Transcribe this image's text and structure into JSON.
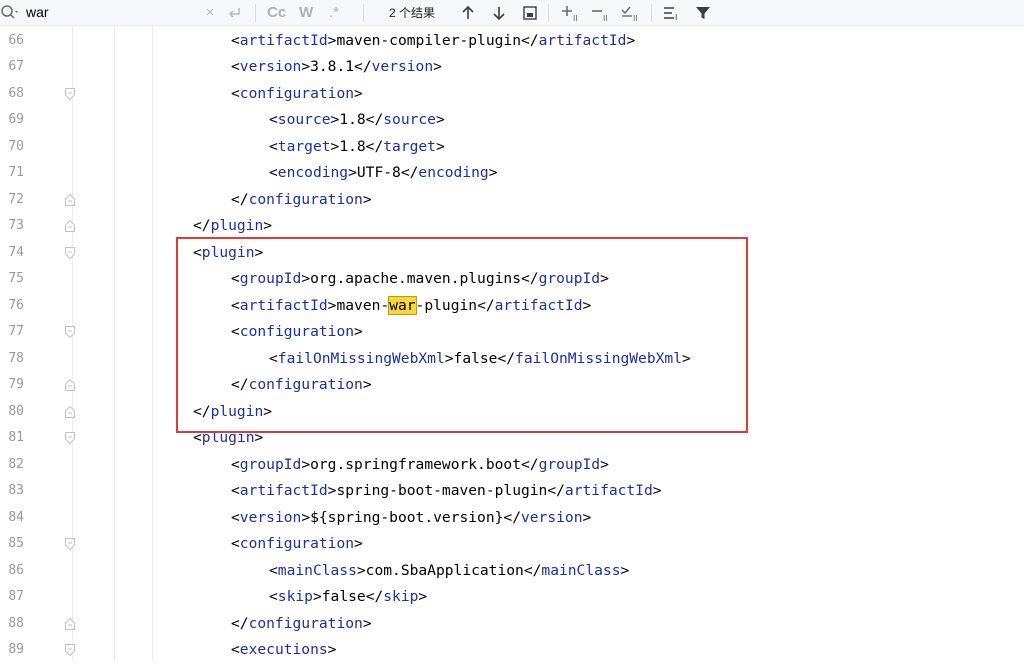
{
  "search": {
    "query": "war",
    "match_case_label": "Cc",
    "words_label": "W",
    "regex_label": ".*",
    "result_count": "2 个结果",
    "icons": [
      "search-icon",
      "clear-icon",
      "replace-toggle-icon",
      "match-case-icon",
      "words-icon",
      "regex-icon",
      "prev-occurrence-icon",
      "next-occurrence-icon",
      "open-in-window-icon",
      "add-selection-icon",
      "remove-selection-icon",
      "select-all-icon",
      "filter-icon",
      "funnel-icon"
    ]
  },
  "editor": {
    "lines": [
      {
        "num": "66",
        "indent": 2,
        "parts": [
          [
            "br",
            "<"
          ],
          [
            "tag",
            "artifactId"
          ],
          [
            "br",
            ">"
          ],
          [
            "txt",
            "maven-compiler-plugin"
          ],
          [
            "br",
            "</"
          ],
          [
            "tag",
            "artifactId"
          ],
          [
            "br",
            ">"
          ]
        ]
      },
      {
        "num": "67",
        "indent": 2,
        "parts": [
          [
            "br",
            "<"
          ],
          [
            "tag",
            "version"
          ],
          [
            "br",
            ">"
          ],
          [
            "txt",
            "3.8.1"
          ],
          [
            "br",
            "</"
          ],
          [
            "tag",
            "version"
          ],
          [
            "br",
            ">"
          ]
        ]
      },
      {
        "num": "68",
        "indent": 2,
        "parts": [
          [
            "br",
            "<"
          ],
          [
            "tag",
            "configuration"
          ],
          [
            "br",
            ">"
          ]
        ]
      },
      {
        "num": "69",
        "indent": 3,
        "parts": [
          [
            "br",
            "<"
          ],
          [
            "tag",
            "source"
          ],
          [
            "br",
            ">"
          ],
          [
            "txt",
            "1.8"
          ],
          [
            "br",
            "</"
          ],
          [
            "tag",
            "source"
          ],
          [
            "br",
            ">"
          ]
        ]
      },
      {
        "num": "70",
        "indent": 3,
        "parts": [
          [
            "br",
            "<"
          ],
          [
            "tag",
            "target"
          ],
          [
            "br",
            ">"
          ],
          [
            "txt",
            "1.8"
          ],
          [
            "br",
            "</"
          ],
          [
            "tag",
            "target"
          ],
          [
            "br",
            ">"
          ]
        ]
      },
      {
        "num": "71",
        "indent": 3,
        "parts": [
          [
            "br",
            "<"
          ],
          [
            "tag",
            "encoding"
          ],
          [
            "br",
            ">"
          ],
          [
            "txt",
            "UTF-8"
          ],
          [
            "br",
            "</"
          ],
          [
            "tag",
            "encoding"
          ],
          [
            "br",
            ">"
          ]
        ]
      },
      {
        "num": "72",
        "indent": 2,
        "parts": [
          [
            "br",
            "</"
          ],
          [
            "tag",
            "configuration"
          ],
          [
            "br",
            ">"
          ]
        ]
      },
      {
        "num": "73",
        "indent": 1,
        "parts": [
          [
            "br",
            "</"
          ],
          [
            "tag",
            "plugin"
          ],
          [
            "br",
            ">"
          ]
        ]
      },
      {
        "num": "74",
        "indent": 1,
        "parts": [
          [
            "br",
            "<"
          ],
          [
            "tag",
            "plugin"
          ],
          [
            "br",
            ">"
          ]
        ]
      },
      {
        "num": "75",
        "indent": 2,
        "parts": [
          [
            "br",
            "<"
          ],
          [
            "tag",
            "groupId"
          ],
          [
            "br",
            ">"
          ],
          [
            "txt",
            "org.apache.maven.plugins"
          ],
          [
            "br",
            "</"
          ],
          [
            "tag",
            "groupId"
          ],
          [
            "br",
            ">"
          ]
        ]
      },
      {
        "num": "76",
        "indent": 2,
        "parts": [
          [
            "br",
            "<"
          ],
          [
            "tag",
            "artifactId"
          ],
          [
            "br",
            ">"
          ],
          [
            "txt",
            "maven-"
          ],
          [
            "hl",
            "war"
          ],
          [
            "txt",
            "-plugin"
          ],
          [
            "br",
            "</"
          ],
          [
            "tag",
            "artifactId"
          ],
          [
            "br",
            ">"
          ]
        ]
      },
      {
        "num": "77",
        "indent": 2,
        "parts": [
          [
            "br",
            "<"
          ],
          [
            "tag",
            "configuration"
          ],
          [
            "br",
            ">"
          ]
        ]
      },
      {
        "num": "78",
        "indent": 3,
        "parts": [
          [
            "br",
            "<"
          ],
          [
            "tag",
            "failOnMissingWebXml"
          ],
          [
            "br",
            ">"
          ],
          [
            "txt",
            "false"
          ],
          [
            "br",
            "</"
          ],
          [
            "tag",
            "failOnMissingWebXml"
          ],
          [
            "br",
            ">"
          ]
        ]
      },
      {
        "num": "79",
        "indent": 2,
        "parts": [
          [
            "br",
            "</"
          ],
          [
            "tag",
            "configuration"
          ],
          [
            "br",
            ">"
          ]
        ]
      },
      {
        "num": "80",
        "indent": 1,
        "parts": [
          [
            "br",
            "</"
          ],
          [
            "tag",
            "plugin"
          ],
          [
            "br",
            ">"
          ]
        ]
      },
      {
        "num": "81",
        "indent": 1,
        "parts": [
          [
            "br",
            "<"
          ],
          [
            "tag",
            "plugin"
          ],
          [
            "br",
            ">"
          ]
        ]
      },
      {
        "num": "82",
        "indent": 2,
        "parts": [
          [
            "br",
            "<"
          ],
          [
            "tag",
            "groupId"
          ],
          [
            "br",
            ">"
          ],
          [
            "txt",
            "org.springframework.boot"
          ],
          [
            "br",
            "</"
          ],
          [
            "tag",
            "groupId"
          ],
          [
            "br",
            ">"
          ]
        ]
      },
      {
        "num": "83",
        "indent": 2,
        "parts": [
          [
            "br",
            "<"
          ],
          [
            "tag",
            "artifactId"
          ],
          [
            "br",
            ">"
          ],
          [
            "txt",
            "spring-boot-maven-plugin"
          ],
          [
            "br",
            "</"
          ],
          [
            "tag",
            "artifactId"
          ],
          [
            "br",
            ">"
          ]
        ]
      },
      {
        "num": "84",
        "indent": 2,
        "parts": [
          [
            "br",
            "<"
          ],
          [
            "tag",
            "version"
          ],
          [
            "br",
            ">"
          ],
          [
            "txt",
            "${spring-boot.version}"
          ],
          [
            "br",
            "</"
          ],
          [
            "tag",
            "version"
          ],
          [
            "br",
            ">"
          ]
        ]
      },
      {
        "num": "85",
        "indent": 2,
        "parts": [
          [
            "br",
            "<"
          ],
          [
            "tag",
            "configuration"
          ],
          [
            "br",
            ">"
          ]
        ]
      },
      {
        "num": "86",
        "indent": 3,
        "parts": [
          [
            "br",
            "<"
          ],
          [
            "tag",
            "mainClass"
          ],
          [
            "br",
            ">"
          ],
          [
            "txt",
            "com.SbaApplication"
          ],
          [
            "br",
            "</"
          ],
          [
            "tag",
            "mainClass"
          ],
          [
            "br",
            ">"
          ]
        ]
      },
      {
        "num": "87",
        "indent": 3,
        "parts": [
          [
            "br",
            "<"
          ],
          [
            "tag",
            "skip"
          ],
          [
            "br",
            ">"
          ],
          [
            "txt",
            "false"
          ],
          [
            "br",
            "</"
          ],
          [
            "tag",
            "skip"
          ],
          [
            "br",
            ">"
          ]
        ]
      },
      {
        "num": "88",
        "indent": 2,
        "parts": [
          [
            "br",
            "</"
          ],
          [
            "tag",
            "configuration"
          ],
          [
            "br",
            ">"
          ]
        ]
      },
      {
        "num": "89",
        "indent": 2,
        "parts": [
          [
            "br",
            "<"
          ],
          [
            "tag",
            "executions"
          ],
          [
            "br",
            ">"
          ]
        ]
      }
    ],
    "fold_markers": [
      {
        "line": "68",
        "kind": "start"
      },
      {
        "line": "72",
        "kind": "end"
      },
      {
        "line": "73",
        "kind": "end"
      },
      {
        "line": "74",
        "kind": "start"
      },
      {
        "line": "77",
        "kind": "start"
      },
      {
        "line": "79",
        "kind": "end"
      },
      {
        "line": "80",
        "kind": "end"
      },
      {
        "line": "81",
        "kind": "start"
      },
      {
        "line": "85",
        "kind": "start"
      },
      {
        "line": "88",
        "kind": "end"
      },
      {
        "line": "89",
        "kind": "start"
      }
    ],
    "colors": {
      "tag": "#1a2fa8",
      "bracket": "#000000",
      "highlight": "#fdd835",
      "annotation_box": "#e53935"
    }
  }
}
